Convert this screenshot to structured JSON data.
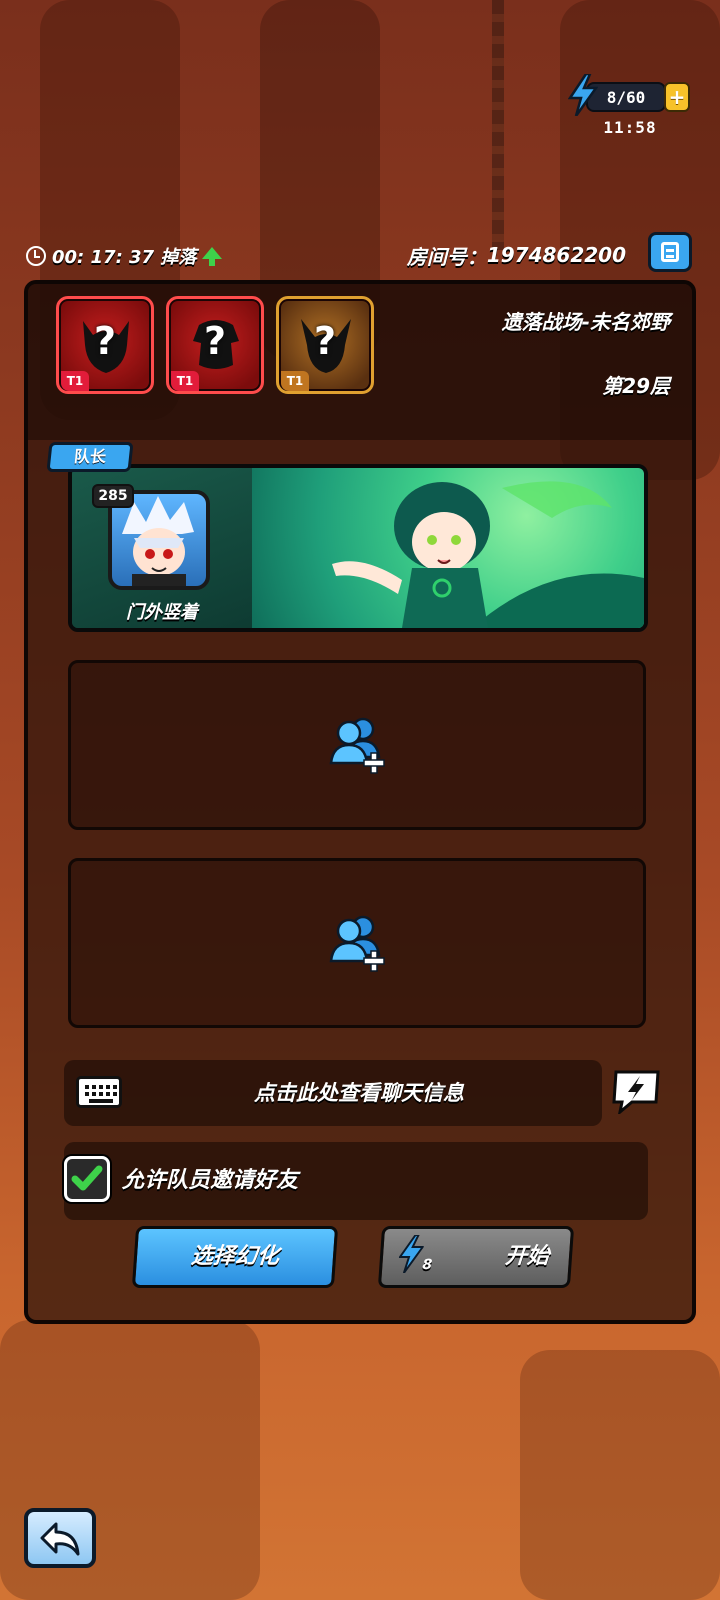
{
  "energy": {
    "value": "8/60",
    "timer": "11:58",
    "plus_label": "+"
  },
  "header": {
    "drop_timer": "00: 17: 37 掉落",
    "room_label": "房间号：",
    "room_number": "1974862200"
  },
  "stage": {
    "bosses": [
      {
        "tier": "T1",
        "unknown": "?",
        "color": "#ff4c4c"
      },
      {
        "tier": "T1",
        "unknown": "?",
        "color": "#ff4c4c"
      },
      {
        "tier": "T1",
        "unknown": "?",
        "color": "#e0a030"
      }
    ],
    "map_name": "遗落战场-未名郊野",
    "floor": "第29层"
  },
  "leader": {
    "tag": "队长",
    "level": "285",
    "name": "门外竖着"
  },
  "chat": {
    "prompt": "点击此处查看聊天信息"
  },
  "invite": {
    "label": "允许队员邀请好友",
    "checked": true
  },
  "buttons": {
    "select_transform": "选择幻化",
    "start_cost": "8",
    "start": "开始"
  },
  "colors": {
    "accent_blue": "#3aa6f0",
    "energy_gold": "#f7c22a",
    "check_green": "#3ed24a"
  },
  "icons": [
    "lightning-icon",
    "plus-icon",
    "clock-icon",
    "arrow-up-icon",
    "copy-icon",
    "boss-silhouette-icon",
    "add-user-icon",
    "keyboard-icon",
    "chat-bubble-icon",
    "checkmark-icon",
    "back-arrow-icon"
  ]
}
